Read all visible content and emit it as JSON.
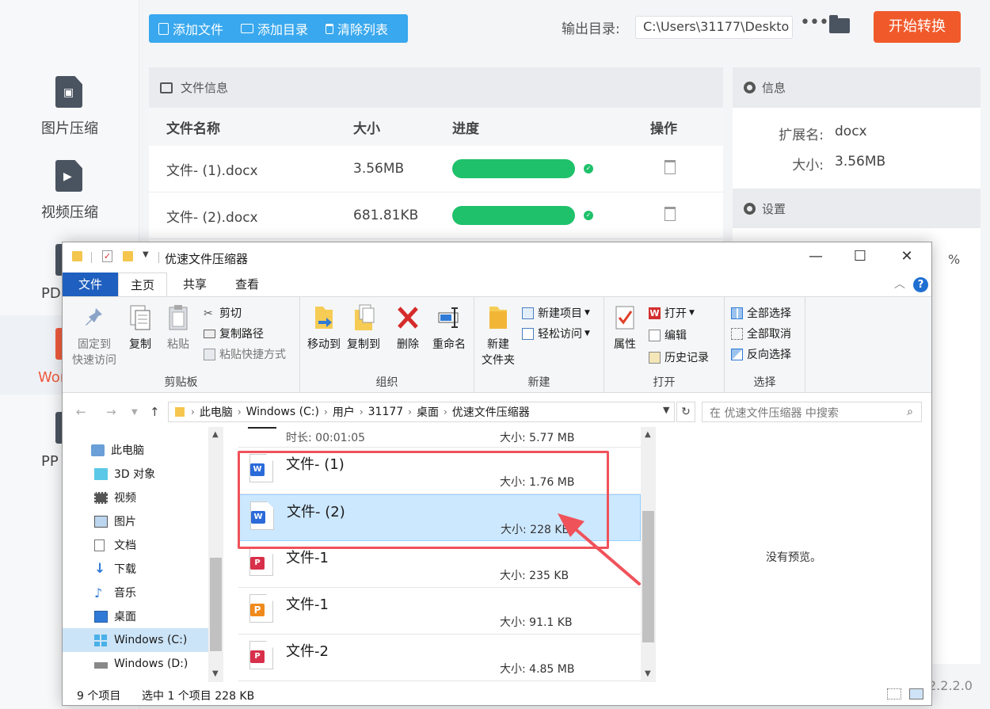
{
  "sidebar": {
    "items": [
      {
        "label": "图片压缩",
        "icon": "image-file-icon"
      },
      {
        "label": "视频压缩",
        "icon": "video-file-icon"
      },
      {
        "label": "PD",
        "icon": "pdf-file-icon"
      },
      {
        "label": "Wor",
        "icon": "word-file-icon"
      },
      {
        "label": "PP",
        "icon": "ppt-file-icon"
      }
    ]
  },
  "toolbar": {
    "add_file": "添加文件",
    "add_dir": "添加目录",
    "clear_list": "清除列表",
    "output_label": "输出目录:",
    "output_path": "C:\\Users\\31177\\Deskto",
    "more": "•••",
    "start": "开始转换"
  },
  "file_panel": {
    "title": "文件信息",
    "columns": [
      "文件名称",
      "大小",
      "进度",
      "操作"
    ],
    "rows": [
      {
        "name": "文件- (1).docx",
        "size": "3.56MB",
        "progress": 1.0
      },
      {
        "name": "文件- (2).docx",
        "size": "681.81KB",
        "progress": 1.0
      }
    ]
  },
  "info_panel": {
    "title": "信息",
    "ext_label": "扩展名:",
    "ext_value": "docx",
    "size_label": "大小:",
    "size_value": "3.56MB"
  },
  "settings_panel": {
    "title": "设置",
    "percent": "%"
  },
  "version": "2.2.2.0",
  "explorer": {
    "title": "优速文件压缩器",
    "tabs": [
      "文件",
      "主页",
      "共享",
      "查看"
    ],
    "help": "?",
    "ribbon": {
      "clipboard": {
        "label": "剪贴板",
        "pin": "固定到\n快速访问",
        "pin_line1": "固定到",
        "pin_line2": "快速访问",
        "copy": "复制",
        "paste": "粘贴",
        "cut": "剪切",
        "copy_path": "复制路径",
        "paste_shortcut": "粘贴快捷方式"
      },
      "organize": {
        "label": "组织",
        "move_to": "移动到",
        "copy_to": "复制到",
        "delete": "删除",
        "rename": "重命名"
      },
      "new": {
        "label": "新建",
        "new_folder_line1": "新建",
        "new_folder_line2": "文件夹",
        "new_item": "新建项目",
        "easy_access": "轻松访问"
      },
      "open": {
        "label": "打开",
        "properties": "属性",
        "open": "打开",
        "edit": "编辑",
        "history": "历史记录"
      },
      "select": {
        "label": "选择",
        "select_all": "全部选择",
        "select_none": "全部取消",
        "invert": "反向选择"
      }
    },
    "address": {
      "crumbs": [
        "此电脑",
        "Windows (C:)",
        "用户",
        "31177",
        "桌面",
        "优速文件压缩器"
      ],
      "search_placeholder": "在 优速文件压缩器 中搜索"
    },
    "nav": [
      {
        "label": "此电脑",
        "icon": "computer-icon"
      },
      {
        "label": "3D 对象",
        "icon": "cube-icon"
      },
      {
        "label": "视频",
        "icon": "film-icon"
      },
      {
        "label": "图片",
        "icon": "picture-icon"
      },
      {
        "label": "文档",
        "icon": "document-icon"
      },
      {
        "label": "下载",
        "icon": "download-icon"
      },
      {
        "label": "音乐",
        "icon": "music-icon"
      },
      {
        "label": "桌面",
        "icon": "desktop-icon"
      },
      {
        "label": "Windows (C:)",
        "icon": "windows-drive-icon"
      },
      {
        "label": "Windows (D:)",
        "icon": "drive-icon"
      }
    ],
    "files": {
      "partial_top": {
        "duration": "时长: 00:01:05",
        "size": "大小: 5.77 MB"
      },
      "items": [
        {
          "name": "文件- (1)",
          "size": "大小: 1.76 MB",
          "type": "word",
          "badge": "W"
        },
        {
          "name": "文件- (2)",
          "size": "大小: 228 KB",
          "type": "word",
          "badge": "W"
        },
        {
          "name": "文件-1",
          "size": "大小: 235 KB",
          "type": "pdf",
          "badge": "P"
        },
        {
          "name": "文件-1",
          "size": "大小: 91.1 KB",
          "type": "ppt",
          "badge": "P"
        },
        {
          "name": "文件-2",
          "size": "大小: 4.85 MB",
          "type": "pdf",
          "badge": "P"
        }
      ]
    },
    "preview": "没有预览。",
    "status": {
      "count": "9 个项目",
      "selected": "选中 1 个项目  228 KB"
    }
  },
  "colors": {
    "accent_blue": "#39a8ee",
    "start_orange": "#f05a2b",
    "progress_green": "#1fc16b",
    "highlight_red": "#f0525a",
    "selection_blue": "#cce8ff"
  }
}
